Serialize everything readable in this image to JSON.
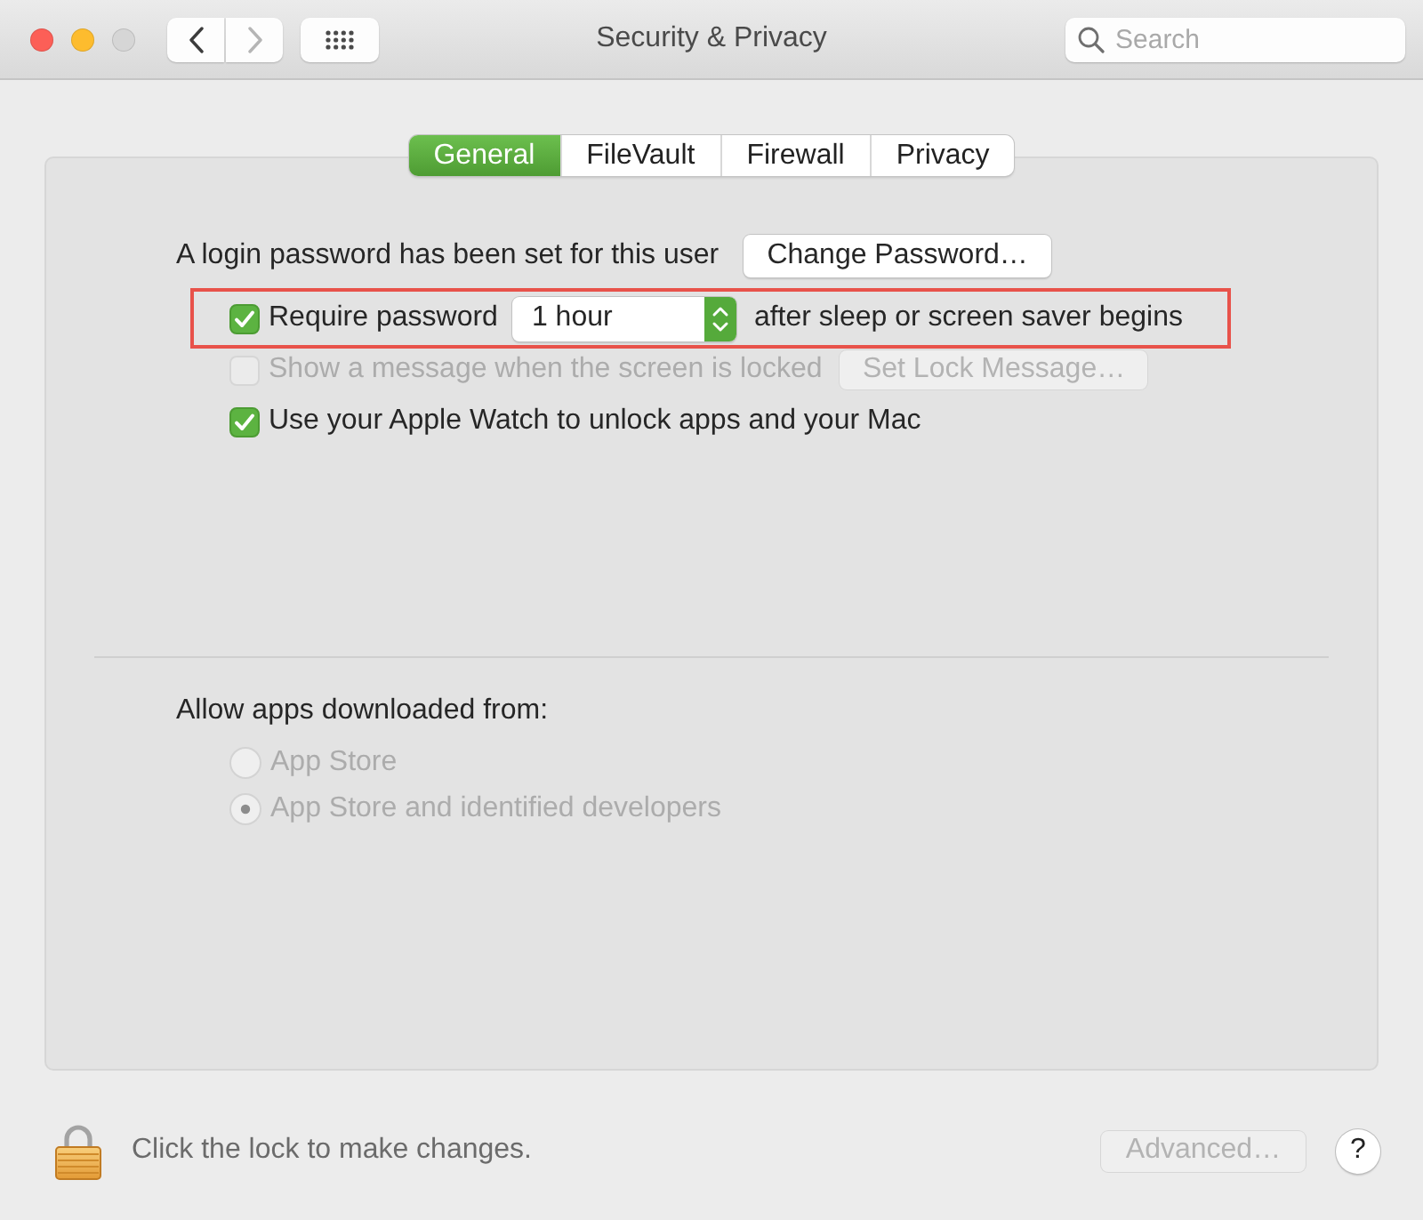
{
  "window": {
    "title": "Security & Privacy",
    "traffic_lights": [
      {
        "color": "#fc5f57"
      },
      {
        "color": "#fdbc2e"
      },
      {
        "color": "#d6d6d6"
      }
    ]
  },
  "toolbar": {
    "back": {
      "disabled": false
    },
    "forward": {
      "disabled": true
    },
    "search": {
      "placeholder": "Search"
    }
  },
  "tabs": [
    {
      "label": "General",
      "selected": true
    },
    {
      "label": "FileVault",
      "selected": false
    },
    {
      "label": "Firewall",
      "selected": false
    },
    {
      "label": "Privacy",
      "selected": false
    }
  ],
  "general": {
    "login_text": "A login password has been set for this user",
    "change_password": {
      "label": "Change Password…",
      "disabled": false
    },
    "options": [
      {
        "kind": "popup",
        "label": "Require password",
        "checked": true,
        "disabled": false,
        "highlighted": true,
        "popup": {
          "value": "1 hour"
        },
        "suffix": "after sleep or screen saver begins"
      },
      {
        "kind": "button",
        "label": "Show a message when the screen is locked",
        "checked": false,
        "disabled": true,
        "button": {
          "label": "Set Lock Message…",
          "disabled": true
        }
      },
      {
        "kind": "plain",
        "label": "Use your Apple Watch to unlock apps and your Mac",
        "checked": true,
        "disabled": false
      }
    ]
  },
  "downloads": {
    "label": "Allow apps downloaded from:",
    "options": [
      {
        "label": "App Store",
        "selected": false,
        "disabled": true
      },
      {
        "label": "App Store and identified developers",
        "selected": true,
        "disabled": true
      }
    ]
  },
  "footer": {
    "locked": true,
    "lock_text": "Click the lock to make changes.",
    "advanced": {
      "label": "Advanced…",
      "disabled": true
    },
    "help": {
      "label": "?"
    }
  }
}
